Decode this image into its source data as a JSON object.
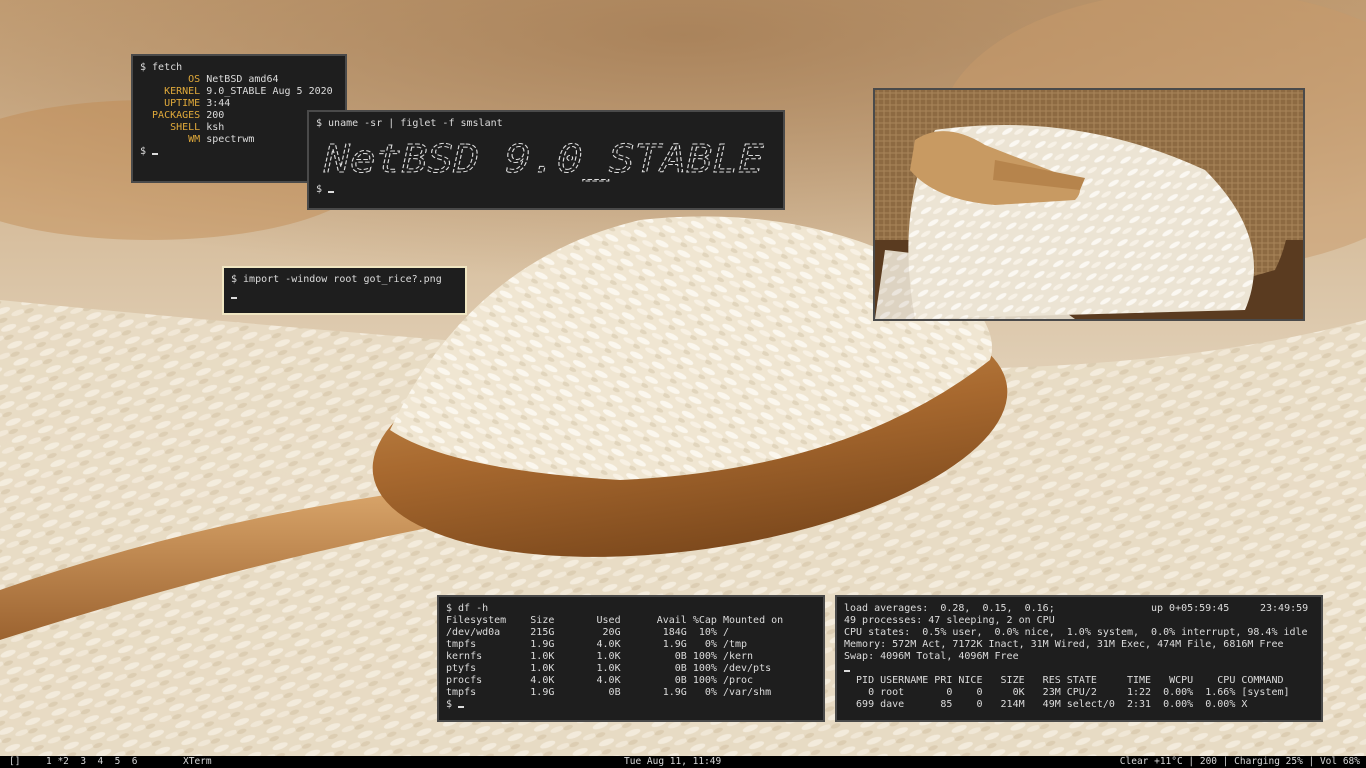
{
  "colors": {
    "terminal_bg": "#1e1e1e",
    "terminal_fg": "#dcdcdc",
    "fetch_key_color": "#e0a93a",
    "focused_border": "#f0e6c2",
    "unfocused_border": "#4a4a4a",
    "bar_bg": "#000000"
  },
  "fetch": {
    "command": "$ fetch",
    "rows": [
      {
        "key": "OS",
        "value": "NetBSD amd64"
      },
      {
        "key": "KERNEL",
        "value": "9.0_STABLE Aug 5 2020"
      },
      {
        "key": "UPTIME",
        "value": "3:44"
      },
      {
        "key": "PACKAGES",
        "value": "200"
      },
      {
        "key": "SHELL",
        "value": "ksh"
      },
      {
        "key": "WM",
        "value": "spectrwm"
      }
    ],
    "prompt": "$ "
  },
  "figlet": {
    "command": "$ uname -sr | figlet -f smslant",
    "art_text": "NetBSD 9.0_STABLE",
    "prompt": "$ "
  },
  "import": {
    "command": "$ import -window root got_rice?.png"
  },
  "df": {
    "command": "$ df -h",
    "header": [
      "Filesystem",
      "Size",
      "Used",
      "Avail",
      "%Cap",
      "Mounted on"
    ],
    "rows": [
      [
        "/dev/wd0a",
        "215G",
        "20G",
        "184G",
        "10%",
        "/"
      ],
      [
        "tmpfs",
        "1.9G",
        "4.0K",
        "1.9G",
        "0%",
        "/tmp"
      ],
      [
        "kernfs",
        "1.0K",
        "1.0K",
        "0B",
        "100%",
        "/kern"
      ],
      [
        "ptyfs",
        "1.0K",
        "1.0K",
        "0B",
        "100%",
        "/dev/pts"
      ],
      [
        "procfs",
        "4.0K",
        "4.0K",
        "0B",
        "100%",
        "/proc"
      ],
      [
        "tmpfs",
        "1.9G",
        "0B",
        "1.9G",
        "0%",
        "/var/shm"
      ]
    ],
    "prompt": "$ "
  },
  "top": {
    "load_line": "load averages:  0.28,  0.15,  0.16;",
    "uptime": "up 0+05:59:45",
    "clock": "23:49:59",
    "processes": "49 processes: 47 sleeping, 2 on CPU",
    "cpu_states": "CPU states:  0.5% user,  0.0% nice,  1.0% system,  0.0% interrupt, 98.4% idle",
    "memory": "Memory: 572M Act, 7172K Inact, 31M Wired, 31M Exec, 474M File, 6816M Free",
    "swap": "Swap: 4096M Total, 4096M Free",
    "header": [
      "PID",
      "USERNAME",
      "PRI",
      "NICE",
      "SIZE",
      "RES",
      "STATE",
      "TIME",
      "WCPU",
      "CPU",
      "COMMAND"
    ],
    "rows": [
      [
        "0",
        "root",
        "0",
        "0",
        "0K",
        "23M",
        "CPU/2",
        "1:22",
        "0.00%",
        "1.66%",
        "[system]"
      ],
      [
        "699",
        "dave",
        "85",
        "0",
        "214M",
        "49M",
        "select/0",
        "2:31",
        "0.00%",
        "0.00%",
        "X"
      ]
    ]
  },
  "bar": {
    "layout_indicator": "[]",
    "workspaces": "1 *2  3  4  5  6",
    "window_title": "XTerm",
    "datetime": "Tue Aug 11, 11:49",
    "status": "Clear +11°C | 200 | Charging 25% | Vol 68%"
  }
}
